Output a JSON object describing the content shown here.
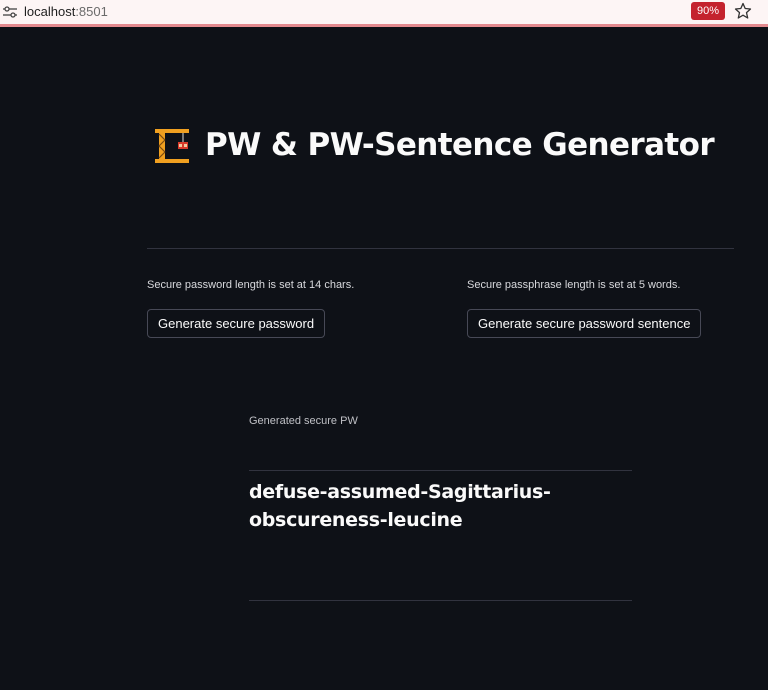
{
  "browser": {
    "url_host": "localhost",
    "url_port": ":8501",
    "zoom": "90%",
    "site_icon": "site-settings-icon",
    "bookmark_icon": "star-icon"
  },
  "header": {
    "emoji": "construction-crane-icon",
    "title": "PW & PW-Sentence Generator"
  },
  "password_section": {
    "caption": "Secure password length is set at 14 chars.",
    "button_label": "Generate secure password"
  },
  "passphrase_section": {
    "caption": "Secure passphrase length is set at 5 words.",
    "button_label": "Generate secure password sentence"
  },
  "result": {
    "label": "Generated secure PW",
    "value": "defuse-assumed-Sagittarius-obscureness-leucine"
  },
  "colors": {
    "background": "#0e1117",
    "text": "#fafafa",
    "divider": "#31333f",
    "zoom_badge": "#c4232e",
    "browser_accent": "#e38a8f"
  }
}
